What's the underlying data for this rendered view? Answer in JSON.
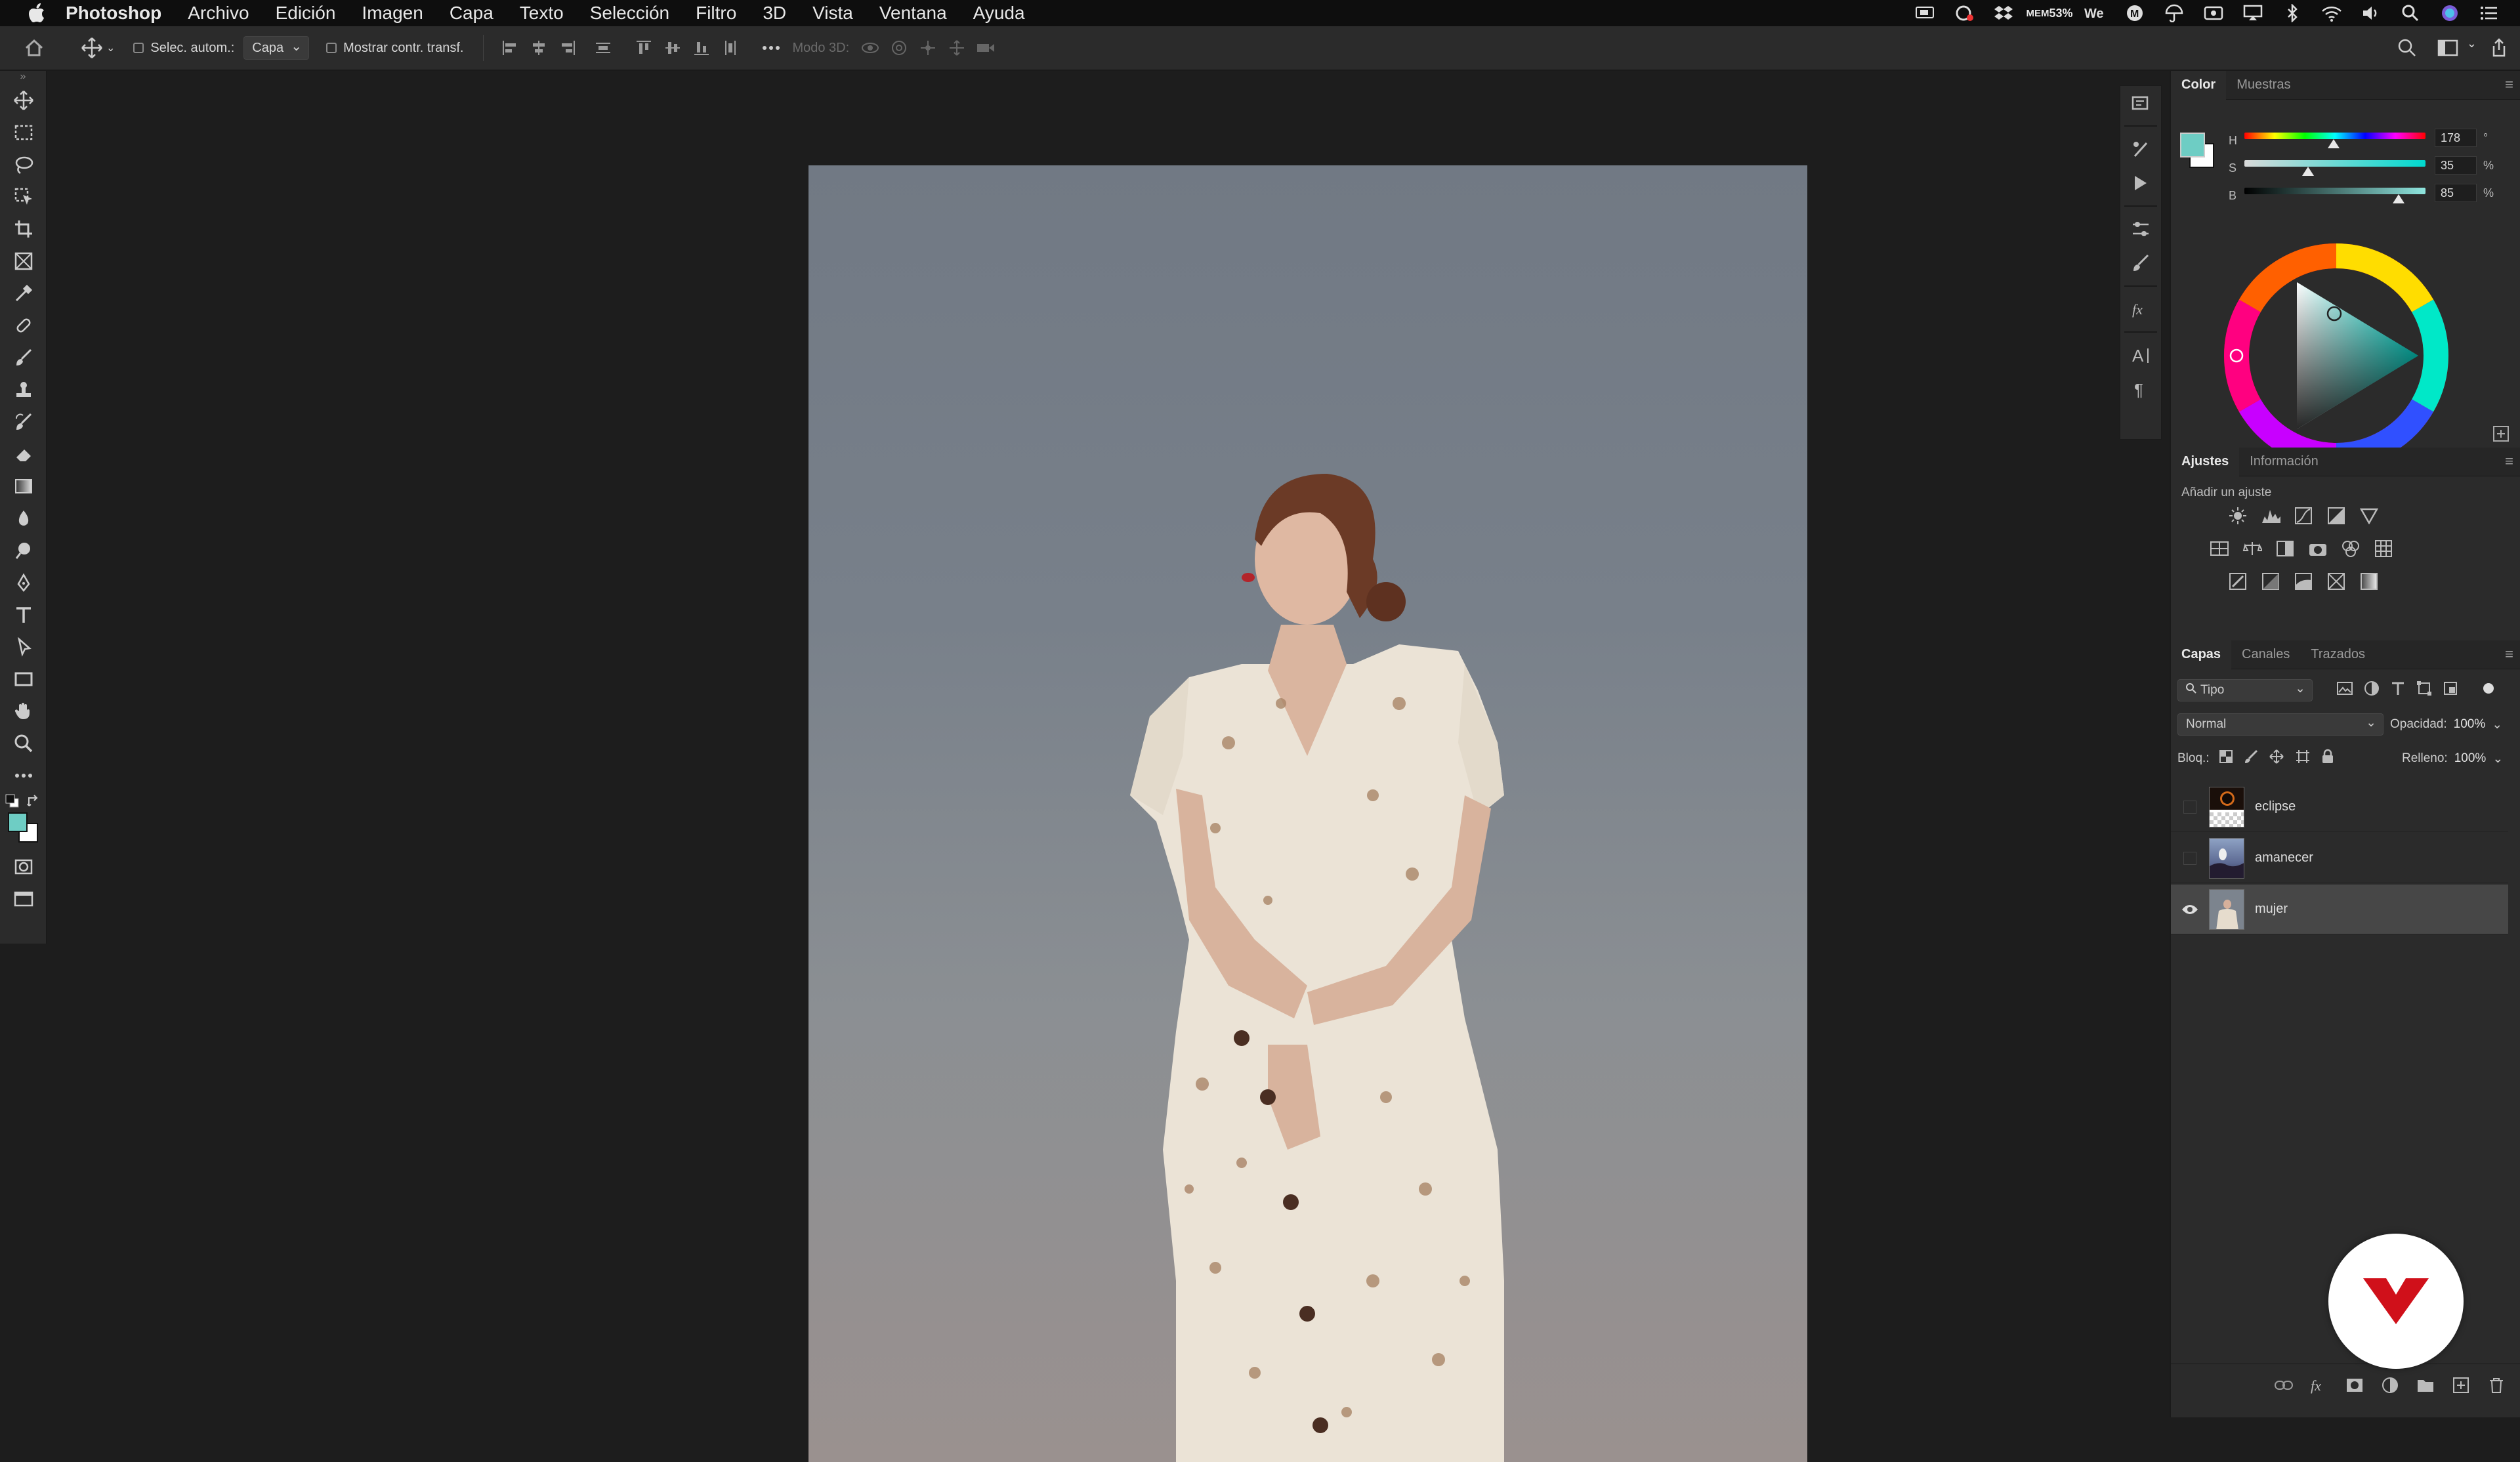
{
  "menubar": {
    "app_name": "Photoshop",
    "items": [
      "Archivo",
      "Edición",
      "Imagen",
      "Capa",
      "Texto",
      "Selección",
      "Filtro",
      "3D",
      "Vista",
      "Ventana",
      "Ayuda"
    ],
    "mem_label": "MEM",
    "mem_value": "53%"
  },
  "options": {
    "auto_select_label": "Selec. autom.:",
    "auto_select_value": "Capa",
    "show_transform_label": "Mostrar contr. transf.",
    "mode3d_label": "Modo 3D:"
  },
  "colors": {
    "foreground": "#6ecdc4",
    "background": "#ffffff",
    "accent_red": "#d0101a"
  },
  "color_panel": {
    "tabs": [
      "Color",
      "Muestras"
    ],
    "active_tab": "Color",
    "h_label": "H",
    "h_value": "178",
    "h_unit": "°",
    "s_label": "S",
    "s_value": "35",
    "s_unit": "%",
    "b_label": "B",
    "b_value": "85",
    "b_unit": "%",
    "h_fraction": 0.494,
    "s_fraction": 0.35,
    "b_fraction": 0.85
  },
  "adjustments_panel": {
    "tabs": [
      "Ajustes",
      "Información"
    ],
    "active_tab": "Ajustes",
    "add_label": "Añadir un ajuste"
  },
  "layers_panel": {
    "tabs": [
      "Capas",
      "Canales",
      "Trazados"
    ],
    "active_tab": "Capas",
    "filter_kind": "Tipo",
    "blend_mode": "Normal",
    "opacity_label": "Opacidad:",
    "opacity_value": "100%",
    "lock_label": "Bloq.:",
    "fill_label": "Relleno:",
    "fill_value": "100%",
    "layers": [
      {
        "name": "eclipse",
        "visible": false,
        "selected": false
      },
      {
        "name": "amanecer",
        "visible": false,
        "selected": false
      },
      {
        "name": "mujer",
        "visible": true,
        "selected": true
      }
    ]
  }
}
